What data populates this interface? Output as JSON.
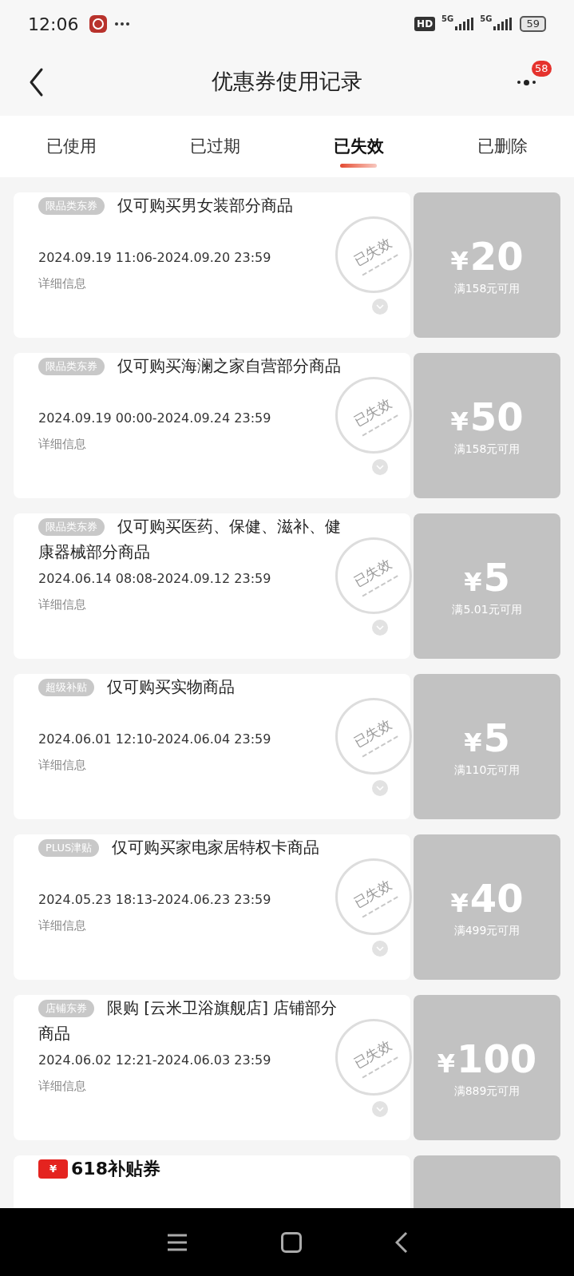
{
  "status_bar": {
    "time": "12:06",
    "hd": "HD",
    "network": [
      "5G",
      "5G"
    ],
    "battery": "59"
  },
  "header": {
    "title": "优惠券使用记录",
    "badge": "58"
  },
  "tabs": [
    {
      "label": "已使用",
      "selected": false
    },
    {
      "label": "已过期",
      "selected": false
    },
    {
      "label": "已失效",
      "selected": true
    },
    {
      "label": "已删除",
      "selected": false
    }
  ],
  "coupons": [
    {
      "kind": "tagged",
      "tag": "限品类东券",
      "title": "仅可购买男女装部分商品",
      "period": "2024.09.19 11:06-2024.09.20 23:59",
      "details": "详细信息",
      "stamp": "已失效",
      "currency": "¥",
      "amount": "20",
      "condition": "满158元可用"
    },
    {
      "kind": "tagged",
      "tag": "限品类东券",
      "title": "仅可购买海澜之家自营部分商品",
      "period": "2024.09.19 00:00-2024.09.24 23:59",
      "details": "详细信息",
      "stamp": "已失效",
      "currency": "¥",
      "amount": "50",
      "condition": "满158元可用"
    },
    {
      "kind": "tagged",
      "tag": "限品类东券",
      "title": "仅可购买医药、保健、滋补、健康器械部分商品",
      "period": "2024.06.14 08:08-2024.09.12 23:59",
      "details": "详细信息",
      "stamp": "已失效",
      "currency": "¥",
      "amount": "5",
      "condition": "满5.01元可用"
    },
    {
      "kind": "tagged",
      "tag": "超级补贴",
      "title": "仅可购买实物商品",
      "period": "2024.06.01 12:10-2024.06.04 23:59",
      "details": "详细信息",
      "stamp": "已失效",
      "currency": "¥",
      "amount": "5",
      "condition": "满110元可用"
    },
    {
      "kind": "tagged",
      "tag": "PLUS津贴",
      "title": "仅可购买家电家居特权卡商品",
      "period": "2024.05.23 18:13-2024.06.23 23:59",
      "details": "详细信息",
      "stamp": "已失效",
      "currency": "¥",
      "amount": "40",
      "condition": "满499元可用"
    },
    {
      "kind": "tagged",
      "tag": "店铺东券",
      "title": "限购 [云米卫浴旗舰店] 店铺部分商品",
      "period": "2024.06.02 12:21-2024.06.03 23:59",
      "details": "详细信息",
      "stamp": "已失效",
      "currency": "¥",
      "amount": "100",
      "condition": "满889元可用"
    },
    {
      "kind": "banner",
      "tag": "¥",
      "title": "618补贴券"
    }
  ]
}
